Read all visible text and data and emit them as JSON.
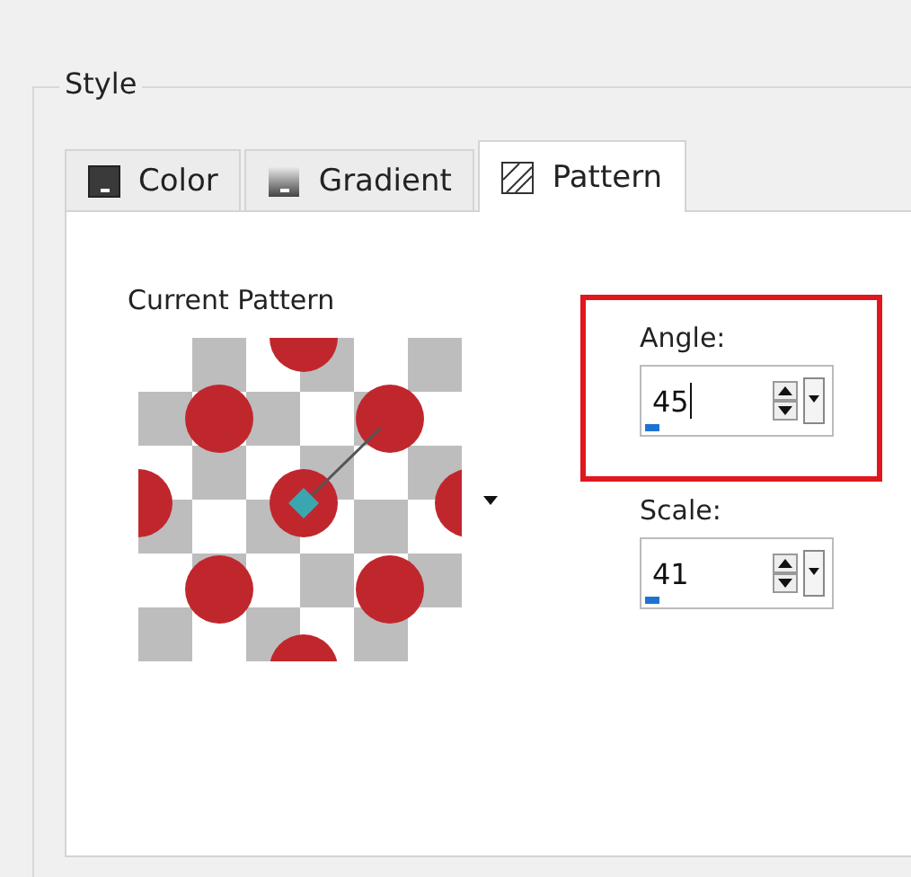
{
  "group": {
    "title": "Style"
  },
  "tabs": [
    {
      "label": "Color",
      "kind": "color",
      "selected": false
    },
    {
      "label": "Gradient",
      "kind": "gradient",
      "selected": false
    },
    {
      "label": "Pattern",
      "kind": "pattern",
      "selected": true
    }
  ],
  "current_pattern": {
    "label": "Current Pattern"
  },
  "fields": [
    {
      "label": "Angle:",
      "value": "45",
      "level": 0.1,
      "highlighted": true,
      "focused": true
    },
    {
      "label": "Scale:",
      "value": "41",
      "level": 0.1,
      "highlighted": false,
      "focused": false
    }
  ]
}
